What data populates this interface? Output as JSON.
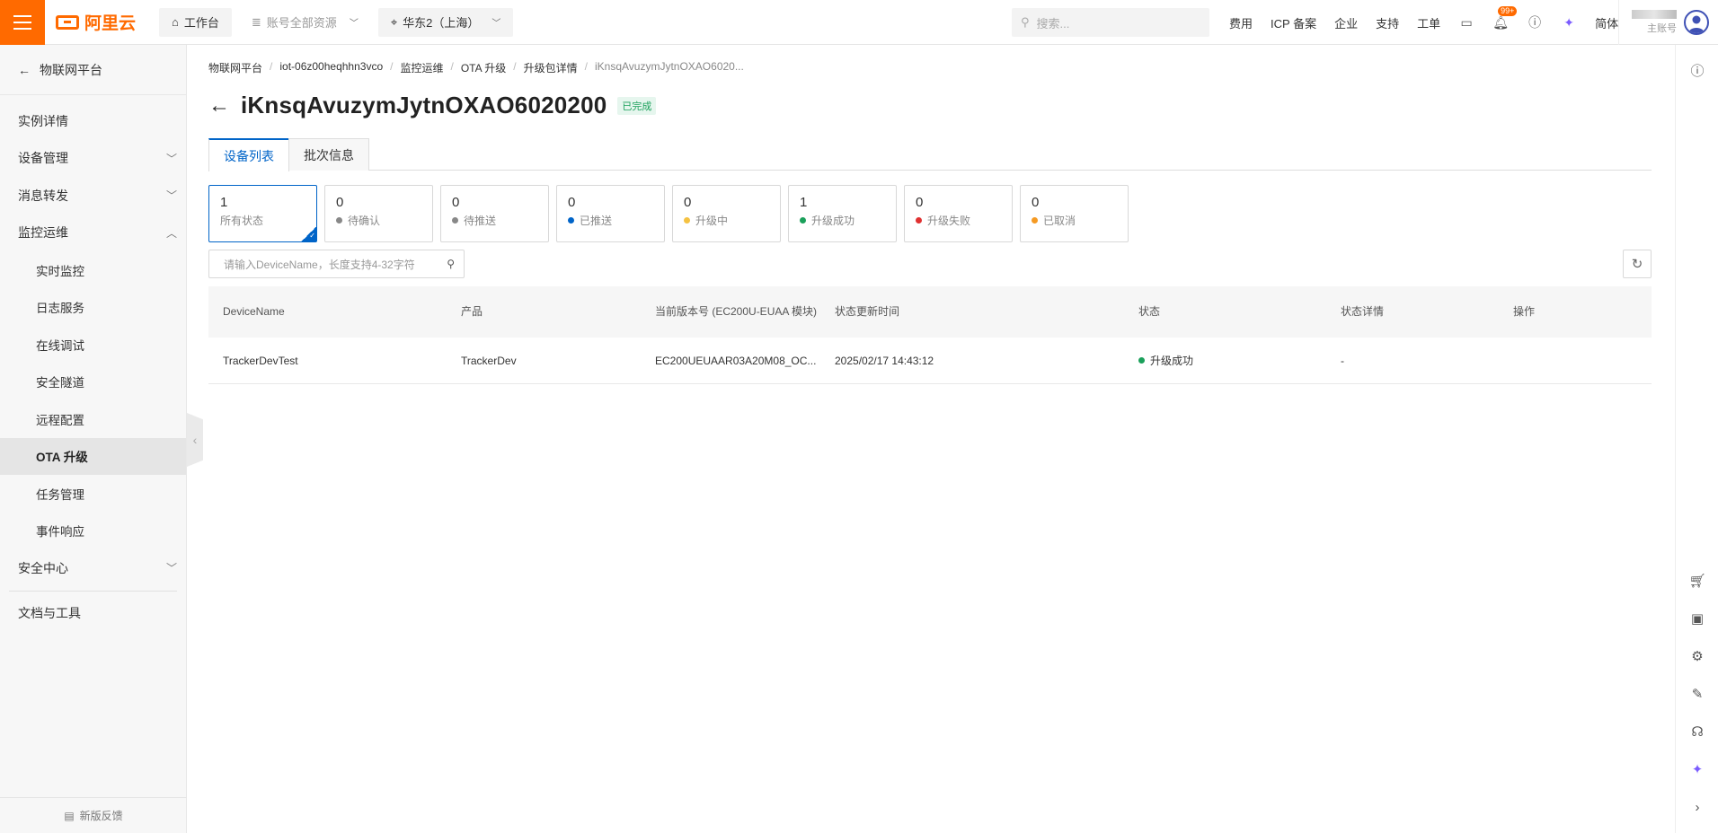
{
  "header": {
    "logo_text": "阿里云",
    "workbench": "工作台",
    "account_resources": "账号全部资源",
    "region": "华东2（上海）",
    "search_placeholder": "搜索...",
    "links": [
      "费用",
      "ICP 备案",
      "企业",
      "支持",
      "工单"
    ],
    "notification_badge": "99+",
    "language": "简体",
    "account_role": "主账号"
  },
  "sidebar": {
    "back_label": "物联网平台",
    "items": [
      {
        "label": "实例详情",
        "type": "top"
      },
      {
        "label": "设备管理",
        "type": "group",
        "expanded": false
      },
      {
        "label": "消息转发",
        "type": "group",
        "expanded": false
      },
      {
        "label": "监控运维",
        "type": "group",
        "expanded": true
      },
      {
        "label": "实时监控",
        "type": "sub"
      },
      {
        "label": "日志服务",
        "type": "sub"
      },
      {
        "label": "在线调试",
        "type": "sub"
      },
      {
        "label": "安全隧道",
        "type": "sub"
      },
      {
        "label": "远程配置",
        "type": "sub"
      },
      {
        "label": "OTA 升级",
        "type": "sub",
        "active": true
      },
      {
        "label": "任务管理",
        "type": "sub"
      },
      {
        "label": "事件响应",
        "type": "sub"
      },
      {
        "label": "安全中心",
        "type": "group",
        "expanded": false
      },
      {
        "label": "文档与工具",
        "type": "top"
      }
    ],
    "feedback": "新版反馈"
  },
  "breadcrumb": [
    "物联网平台",
    "iot-06z00heqhhn3vco",
    "监控运维",
    "OTA 升级",
    "升级包详情",
    "iKnsqAvuzymJytnOXAO6020..."
  ],
  "page": {
    "title": "iKnsqAvuzymJytnOXAO6020200",
    "status": "已完成",
    "tabs": [
      "设备列表",
      "批次信息"
    ]
  },
  "stats": [
    {
      "count": "1",
      "label": "所有状态",
      "color": "",
      "active": true
    },
    {
      "count": "0",
      "label": "待确认",
      "color": "#888888"
    },
    {
      "count": "0",
      "label": "待推送",
      "color": "#888888"
    },
    {
      "count": "0",
      "label": "已推送",
      "color": "#0064c8"
    },
    {
      "count": "0",
      "label": "升级中",
      "color": "#f5c242"
    },
    {
      "count": "1",
      "label": "升级成功",
      "color": "#1aa05a"
    },
    {
      "count": "0",
      "label": "升级失败",
      "color": "#e03131"
    },
    {
      "count": "0",
      "label": "已取消",
      "color": "#f59a23"
    }
  ],
  "filter": {
    "placeholder": "请输入DeviceName，长度支持4-32字符"
  },
  "table": {
    "columns": [
      "DeviceName",
      "产品",
      "当前版本号 (EC200U-EUAA 模块)",
      "状态更新时间",
      "状态",
      "状态详情",
      "操作"
    ],
    "rows": [
      {
        "device_name": "TrackerDevTest",
        "product": "TrackerDev",
        "version": "EC200UEUAAR03A20M08_OC...",
        "updated": "2025/02/17 14:43:12",
        "status": "升级成功",
        "status_color": "#1aa05a",
        "detail": "-",
        "action": ""
      }
    ]
  }
}
